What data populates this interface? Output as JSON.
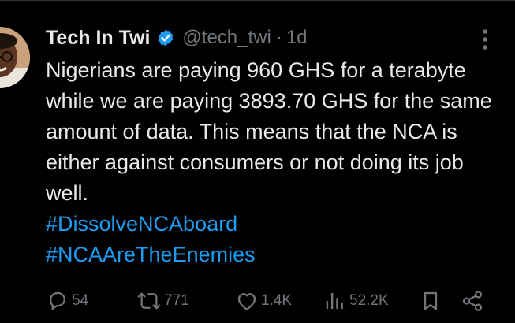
{
  "tweet": {
    "author": {
      "display_name": "Tech In Twi",
      "handle": "@tech_twi",
      "verified": true
    },
    "separator": "·",
    "time": "1d",
    "text": "Nigerians are paying 960 GHS for a terabyte while we are paying 3893.70 GHS for the same amount of data. This means that the NCA is either against consumers or not doing its job well.",
    "hashtags": [
      "#DissolveNCAboard",
      "#NCAAreTheEnemies"
    ],
    "stats": {
      "replies": "54",
      "reposts": "771",
      "likes": "1.4K",
      "views": "52.2K"
    }
  },
  "colors": {
    "background": "#000000",
    "text": "#e7e9ea",
    "muted": "#71767b",
    "accent": "#1d9bf0"
  },
  "icons": {
    "verified": "verified-badge-icon",
    "more": "more-vertical-icon",
    "reply": "reply-icon",
    "repost": "repost-icon",
    "like": "like-icon",
    "views": "views-icon",
    "bookmark": "bookmark-icon",
    "share": "share-icon"
  }
}
